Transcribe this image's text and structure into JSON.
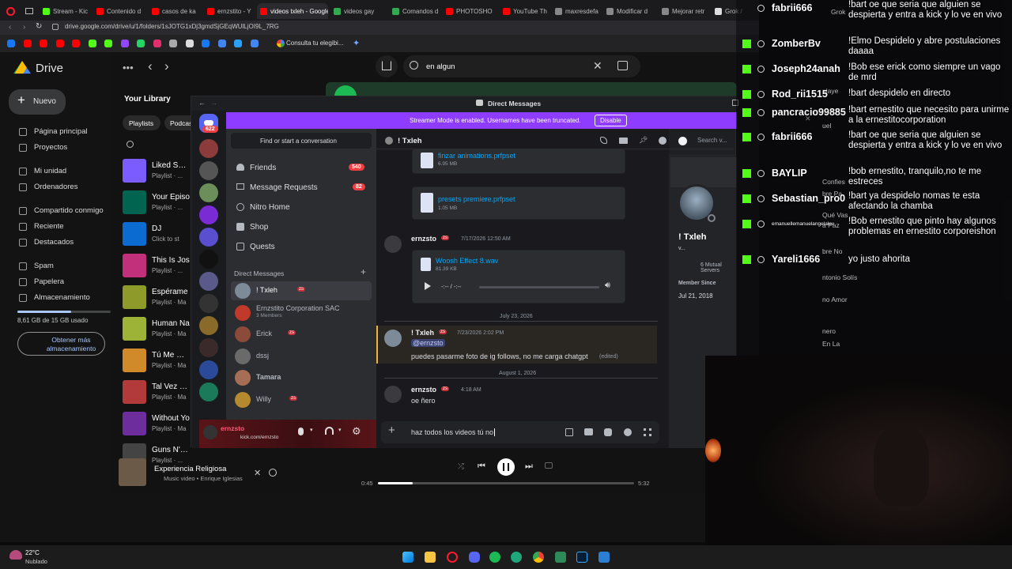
{
  "browser": {
    "tabs": [
      {
        "label": "Stream - Kic",
        "color": "#53fc18"
      },
      {
        "label": "Contenido d",
        "color": "#ff0000"
      },
      {
        "label": "casos de ka",
        "color": "#ff0000"
      },
      {
        "label": "ernzstito - Y",
        "color": "#ff0000"
      },
      {
        "label": "videos txleh - Google",
        "color": "#ff0000"
      },
      {
        "label": "videos gay",
        "color": "#34a853"
      },
      {
        "label": "Comandos d",
        "color": "#34a853"
      },
      {
        "label": "PHOTOSHO",
        "color": "#ff0000"
      },
      {
        "label": "YouTube Th",
        "color": "#ff0000"
      },
      {
        "label": "maxresdefa",
        "color": "#888888"
      },
      {
        "label": "Modificar d",
        "color": "#888888"
      },
      {
        "label": "Mejorar retr",
        "color": "#888888"
      },
      {
        "label": "Grok /",
        "color": "#dddddd"
      }
    ],
    "url": "drive.google.com/drive/u/1/folders/1sJOTG1xDj3gmdSjGEqWUlLjOI9L_7RG",
    "bookmark_label": "Consulta tu elegibi..."
  },
  "drive": {
    "brand": "Drive",
    "new_label": "Nuevo",
    "nav": [
      "Página principal",
      "Proyectos",
      "Mi unidad",
      "Ordenadores",
      "Compartido conmigo",
      "Reciente",
      "Destacados",
      "Spam",
      "Papelera",
      "Almacenamiento"
    ],
    "storage_text": "8,61 GB de 15 GB usado",
    "storage_fraction": 0.574,
    "more_storage": "Obtener más almacenamiento"
  },
  "spotify": {
    "search_query": "en algun",
    "library_title": "Your Library",
    "chips": [
      "Playlists",
      "Podcas"
    ],
    "library": [
      {
        "title": "Liked Song",
        "sub": "Playlist · ...",
        "color": "#7b5cff"
      },
      {
        "title": "Your Episo",
        "sub": "Playlist · ...",
        "color": "#006450"
      },
      {
        "title": "DJ",
        "sub": "Click to st",
        "color": "#0c6bd1"
      },
      {
        "title": "This Is Jos",
        "sub": "Playlist · ...",
        "color": "#c22f7a"
      },
      {
        "title": "Espérame",
        "sub": "Playlist · Ma",
        "color": "#8e9b2a"
      },
      {
        "title": "Human Na",
        "sub": "Playlist · Ma",
        "color": "#9db337"
      },
      {
        "title": "Tú Me Que",
        "sub": "Playlist · Ma",
        "color": "#d08a2a"
      },
      {
        "title": "Tal Vez Rad",
        "sub": "Playlist · Ma",
        "color": "#b33a3a"
      },
      {
        "title": "Without Yo",
        "sub": "Playlist · Ma",
        "color": "#6d2d9c"
      },
      {
        "title": "Guns N' Ros",
        "sub": "Playlist · ...",
        "color": "#444444"
      }
    ],
    "now_playing": {
      "title": "Experiencia Religiosa",
      "subtitle": "Music video • Enrique Iglesias",
      "time_current": "0:45",
      "time_total": "5:32",
      "progress_fraction": 0.136
    }
  },
  "discord": {
    "window_title": "Direct Messages",
    "server_badge": "622",
    "streamer_text": "Streamer Mode is enabled. Usernames have been truncated.",
    "disable_label": "Disable",
    "find_placeholder": "Find or start a conversation",
    "friends": "Friends",
    "friends_count": "540",
    "requests": "Message Requests",
    "requests_count": "82",
    "nitro": "Nitro Home",
    "shop": "Shop",
    "quests": "Quests",
    "dm_header": "Direct Messages",
    "dms": [
      {
        "name": "! Txleh",
        "sub": "",
        "tag": "zs",
        "color": "#7d8a98"
      },
      {
        "name": "Ernzstito Corporation SAC",
        "sub": "3 Members",
        "tag": "",
        "color": "#c0392b"
      },
      {
        "name": "Erick",
        "sub": "",
        "tag": "zs",
        "color": "#8b4a3a"
      },
      {
        "name": "dssj",
        "sub": "",
        "tag": "",
        "color": "#6a6a6a"
      },
      {
        "name": "Tamara",
        "sub": "",
        "tag": "",
        "color": "#a66f55"
      },
      {
        "name": "Willy",
        "sub": "",
        "tag": "zs",
        "color": "#b58a2f"
      }
    ],
    "self_name": "ernzsto",
    "self_status": "kick.com/ernzsto",
    "channel_name": "! Txleh",
    "search_placeholder": "Search v...",
    "files": [
      {
        "name": "finzar animations.prfpset",
        "size": "6.95 MB"
      },
      {
        "name": "presets premiere.prfpset",
        "size": "1.05 MB"
      }
    ],
    "audio": {
      "author": "ernzsto",
      "tag": "zs",
      "time": "7/17/2026 12:50 AM",
      "name": "Woosh Effect 8.wav",
      "size": "81.39 KB",
      "duration": "-:-- / -:--"
    },
    "divider1": "July 23, 2026",
    "reply": {
      "author": "! Txleh",
      "tag": "zs",
      "time": "7/23/2026 2:02 PM",
      "mention": "@ernzsto",
      "text": "puedes pasarme foto de ig follows, no me carga chatgpt",
      "edited": "(edited)"
    },
    "divider2": "August 1, 2026",
    "last": {
      "author": "ernzsto",
      "tag": "zs",
      "time": "4:18 AM",
      "text": "oe ñero"
    },
    "composer_value": "haz todos los videos tú no",
    "profile": {
      "name": "! Txleh",
      "handle": "v...",
      "mutual": "6 Mutual Servers",
      "since_label": "Member Since",
      "since": "Jul 21, 2018"
    }
  },
  "chat": {
    "users": [
      "fabrii666",
      "ZomberBv",
      "Joseph24anah",
      "Rod_rii1515",
      "pancracio99885",
      "fabrii666",
      "BAYLIP",
      "Sebastian_pro0",
      "emanuellemanuelangelalev",
      "Yareli1666"
    ],
    "messages": [
      "!bart oe que seria que alguien se despierta y entra a kick y lo ve en vivo",
      "!Elmo Despidelo y abre postulaciones daaaa",
      "!Bob ese erick como siempre un vago de mrd",
      "!bart despidelo en directo",
      "!bart ernestito que necesito para unirme a la ernestitocorporation",
      "!bart oe que seria que alguien se despierta y entra a kick y lo ve en vivo",
      "!bob ernestito, tranquilo,no te me estreces",
      "!bart ya despidelo nomas te esta afectando la chamba",
      "!Bob ernestito que pinto hay algunos problemas en ernestito corporeishon",
      "yo justo ahorita"
    ],
    "bg_fragments": [
      "Grok",
      "playe",
      "uel",
      "Confies",
      "bre Pa",
      "Qué Vas",
      "a Paz",
      "bre No",
      "ntonio Solís",
      "no Amor",
      "nero",
      "En La",
      "uel"
    ]
  },
  "taskbar": {
    "temp": "22°C",
    "weather": "Nublado"
  }
}
